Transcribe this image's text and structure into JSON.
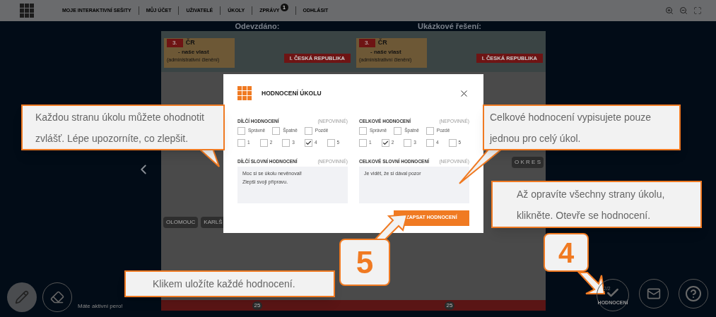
{
  "nav": {
    "items": [
      {
        "label": "MOJE INTERAKTIVNÍ SEŠITY"
      },
      {
        "label": "MŮJ ÚČET"
      },
      {
        "label": "UŽIVATELÉ"
      },
      {
        "label": "ÚKOLY"
      },
      {
        "label": "ZPRÁVY",
        "badge": "1"
      },
      {
        "label": "ODHLÁSIT"
      }
    ]
  },
  "pages": [
    {
      "caption": "Odevzdáno:",
      "number": "3.",
      "title": "ČR",
      "subtitle": "- naše vlast",
      "note": "(administrativní členění)",
      "section": "I. ČESKÁ REPUBLIKA",
      "page_number": "25",
      "labels": [
        "OLOMOUC",
        "KARLŠ"
      ]
    },
    {
      "caption": "Ukázkové řešení:",
      "number": "3.",
      "title": "ČR",
      "subtitle": "- naše vlast",
      "note": "(administrativní členění)",
      "section": "I. ČESKÁ REPUBLIKA",
      "page_number": "25",
      "labels": [
        "O K R E S"
      ]
    }
  ],
  "modal": {
    "title": "HODNOCENÍ ÚKOLU",
    "columns": [
      {
        "heading": "DÍLČÍ HODNOCENÍ",
        "optional": "(NEPOVINNÉ)",
        "marks": [
          {
            "label": "Správně",
            "checked": false
          },
          {
            "label": "Špatně",
            "checked": false
          },
          {
            "label": "Pozdě",
            "checked": false
          }
        ],
        "grades": [
          {
            "label": "1",
            "checked": false
          },
          {
            "label": "2",
            "checked": false
          },
          {
            "label": "3",
            "checked": false
          },
          {
            "label": "4",
            "checked": true
          },
          {
            "label": "5",
            "checked": false
          }
        ],
        "comment_heading": "DÍLČÍ SLOVNÍ HODNOCENÍ",
        "comment_optional": "(NEPOVINNÉ)",
        "comment": "Moc si se úkolu nevěnoval!\nZlepši svoji přípravu."
      },
      {
        "heading": "CELKOVÉ HODNOCENÍ",
        "optional": "(NEPOVINNÉ)",
        "marks": [
          {
            "label": "Správně",
            "checked": false
          },
          {
            "label": "Špatně",
            "checked": false
          },
          {
            "label": "Pozdě",
            "checked": false
          }
        ],
        "grades": [
          {
            "label": "1",
            "checked": false
          },
          {
            "label": "2",
            "checked": true
          },
          {
            "label": "3",
            "checked": false
          },
          {
            "label": "4",
            "checked": false
          },
          {
            "label": "5",
            "checked": false
          }
        ],
        "comment_heading": "CELKOVÉ SLOVNÍ HODNOCENÍ",
        "comment_optional": "(NEPOVINNÉ)",
        "comment": "Je vidět, že si dával pozor"
      }
    ],
    "submit": "ZAPSAT HODNOCENÍ"
  },
  "callouts": [
    {
      "text": "Každou stranu úkolu můžete ohodnotit zvlášť. Lépe upozorníte, co zlepšit."
    },
    {
      "text": "Celkové hodnocení vypisujete pouze jednou pro celý úkol."
    },
    {
      "text": "Až opravíte všechny strany úkolu, klikněte. Otevře se hodnocení."
    },
    {
      "text": "Klikem uložíte každé hodnocení."
    }
  ],
  "steps": [
    {
      "label": "5"
    },
    {
      "label": "4"
    }
  ],
  "toolbar": {
    "tools": [
      {
        "kind": "pen",
        "selected": true
      },
      {
        "kind": "eraser",
        "selected": false
      }
    ],
    "status": "Máte aktivní pero!",
    "evaluate": {
      "count": "2/2",
      "label": "HODNOCENÍ"
    }
  }
}
